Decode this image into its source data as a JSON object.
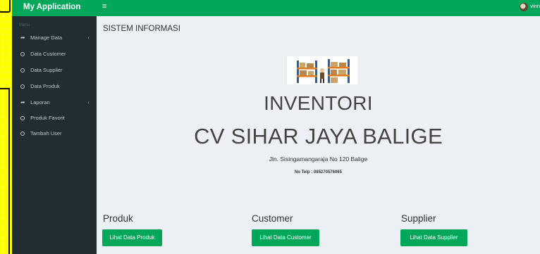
{
  "app": {
    "brand": "My Application",
    "menu_header": "Menu",
    "user_name": "vinn"
  },
  "sidebar": {
    "items": [
      {
        "label": "Manage Data",
        "icon": "share-icon",
        "has_submenu": true
      },
      {
        "label": "Data Customer",
        "icon": "circle-icon"
      },
      {
        "label": "Data Supplier",
        "icon": "circle-icon"
      },
      {
        "label": "Data Produk",
        "icon": "circle-icon"
      },
      {
        "label": "Laporan",
        "icon": "share-icon",
        "has_submenu": true
      },
      {
        "label": "Produk Favorit",
        "icon": "circle-icon"
      },
      {
        "label": "Tambah User",
        "icon": "circle-icon"
      }
    ]
  },
  "content": {
    "page_title": "SISTEM INFORMASI",
    "heading": "INVENTORI",
    "company": "CV SIHAR JAYA BALIGE",
    "address": "Jln. Sisingamangaraja No 120 Balige",
    "phone": "No Telp : 085270576065"
  },
  "cards": {
    "produk": {
      "title": "Produk",
      "button": "Lihat Data Produk"
    },
    "customer": {
      "title": "Customer",
      "button": "Lihat Data Customer"
    },
    "supplier": {
      "title": "Supplier",
      "button": "Lihat Data Supplier"
    }
  },
  "colors": {
    "accent": "#00a65a",
    "sidebar": "#222d32",
    "content_bg": "#ecf0f5",
    "desktop": "#ffff00"
  }
}
